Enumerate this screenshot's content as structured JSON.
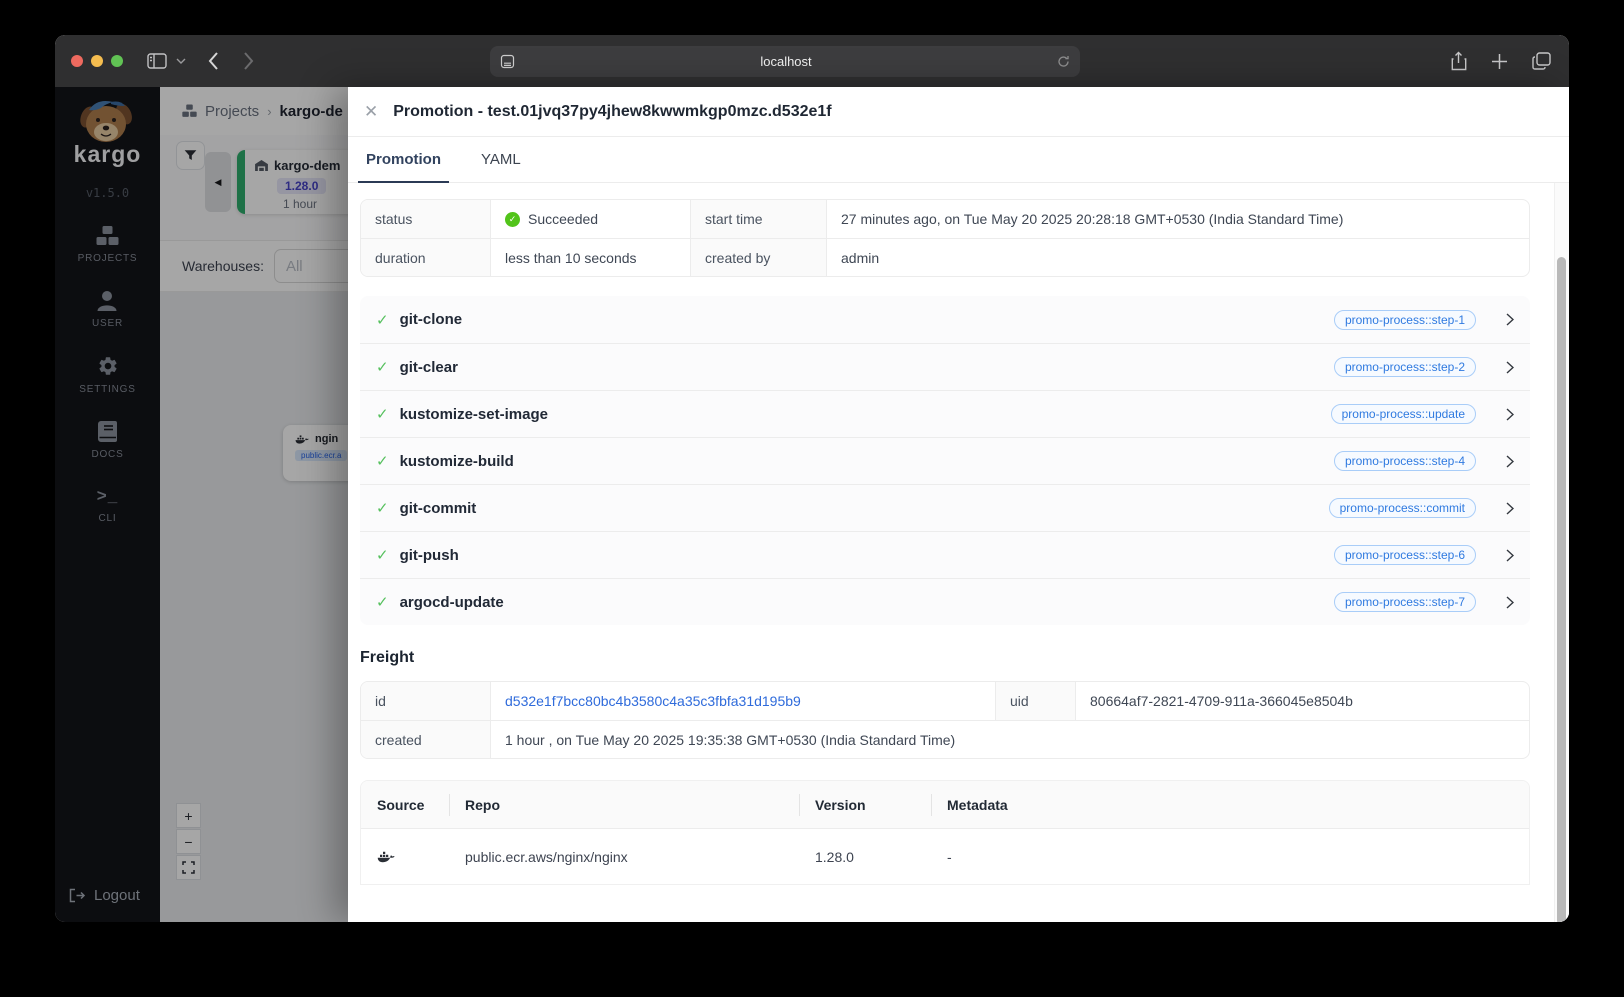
{
  "browser": {
    "url": "localhost"
  },
  "sidebar": {
    "brand": "kargo",
    "version": "v1.5.0",
    "nav": [
      {
        "label": "PROJECTS"
      },
      {
        "label": "USER"
      },
      {
        "label": "SETTINGS"
      },
      {
        "label": "DOCS"
      },
      {
        "label": "CLI"
      }
    ],
    "logout_label": "Logout"
  },
  "page": {
    "breadcrumb_root": "Projects",
    "breadcrumb_sep": "›",
    "breadcrumb_current": "kargo-de",
    "stage_card": {
      "name": "kargo-dem",
      "version": "1.28.0",
      "age": "1 hour"
    },
    "warehouses_label": "Warehouses:",
    "warehouses_value": "All",
    "node": {
      "name": "ngin",
      "registry": "public.ecr.a"
    }
  },
  "modal": {
    "title": "Promotion - test.01jvq37py4jhew8kwwmkgp0mzc.d532e1f",
    "tabs": {
      "promotion": "Promotion",
      "yaml": "YAML"
    },
    "summary": {
      "status_label": "status",
      "status_value": "Succeeded",
      "start_time_label": "start time",
      "start_time_value": "27 minutes ago, on Tue May 20 2025 20:28:18 GMT+0530 (India Standard Time)",
      "duration_label": "duration",
      "duration_value": "less than 10 seconds",
      "created_by_label": "created by",
      "created_by_value": "admin"
    },
    "steps": [
      {
        "name": "git-clone",
        "badge": "promo-process::step-1"
      },
      {
        "name": "git-clear",
        "badge": "promo-process::step-2"
      },
      {
        "name": "kustomize-set-image",
        "badge": "promo-process::update"
      },
      {
        "name": "kustomize-build",
        "badge": "promo-process::step-4"
      },
      {
        "name": "git-commit",
        "badge": "promo-process::commit"
      },
      {
        "name": "git-push",
        "badge": "promo-process::step-6"
      },
      {
        "name": "argocd-update",
        "badge": "promo-process::step-7"
      }
    ],
    "freight": {
      "heading": "Freight",
      "id_label": "id",
      "id_value": "d532e1f7bcc80bc4b3580c4a35c3fbfa31d195b9",
      "uid_label": "uid",
      "uid_value": "80664af7-2821-4709-911a-366045e8504b",
      "created_label": "created",
      "created_value": "1 hour , on Tue May 20 2025 19:35:38 GMT+0530 (India Standard Time)"
    },
    "artifacts": {
      "columns": {
        "source": "Source",
        "repo": "Repo",
        "version": "Version",
        "metadata": "Metadata"
      },
      "rows": [
        {
          "repo": "public.ecr.aws/nginx/nginx",
          "version": "1.28.0",
          "metadata": "-"
        }
      ]
    }
  },
  "glyphs": {
    "check": "✓",
    "close": "✕",
    "plus": "+",
    "minus": "−",
    "collapse": "◀",
    "cli": ">_"
  },
  "colors": {
    "tab_active": "#32435f",
    "success_green": "#52c41a",
    "badge_blue": "#2f7ae0",
    "link_blue": "#2f6bdb"
  }
}
